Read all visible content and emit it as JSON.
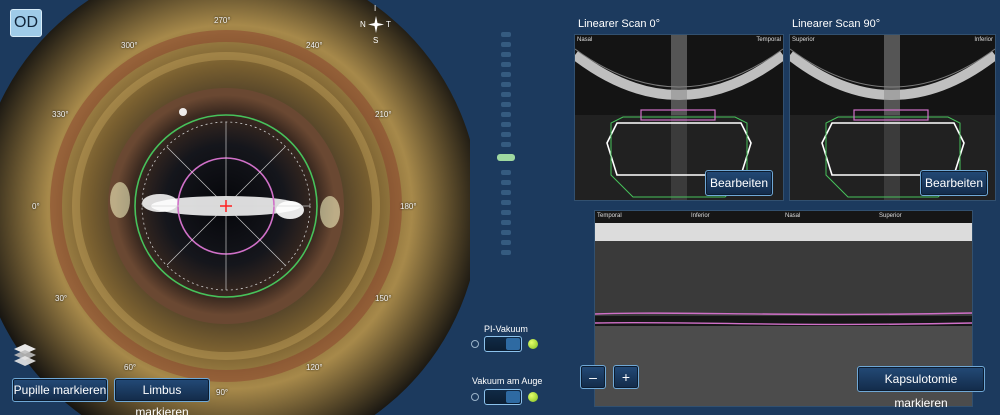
{
  "eye_view": {
    "eye_label": "OD",
    "degree_labels": [
      "270°",
      "240°",
      "210°",
      "180°",
      "150°",
      "120°",
      "90°",
      "60°",
      "30°",
      "0°",
      "330°",
      "300°"
    ],
    "compass": {
      "top": "I",
      "left": "N",
      "right": "T",
      "bottom": "S"
    },
    "buttons": {
      "pupil": "Pupille markieren",
      "limbus": "Limbus markieren"
    }
  },
  "controls": {
    "pi_vacuum_label": "PI-Vakuum",
    "eye_vacuum_label": "Vakuum am Auge"
  },
  "scans": {
    "scan0": {
      "title": "Linearer Scan 0°",
      "left_label": "Nasal",
      "right_label": "Temporal",
      "edit_label": "Bearbeiten"
    },
    "scan90": {
      "title": "Linearer Scan 90°",
      "left_label": "Superior",
      "right_label": "Inferior",
      "edit_label": "Bearbeiten"
    },
    "circular": {
      "labels": [
        "Temporal",
        "Inferior",
        "Nasal",
        "Superior"
      ]
    }
  },
  "bottom_controls": {
    "zoom_out": "–",
    "zoom_in": "+",
    "capsulotomy": "Kapsulotomie markieren"
  },
  "colors": {
    "background": "#1c3a5e",
    "green_ring": "#47c25b",
    "pink_ring": "#d070c8",
    "accent": "#6fa8d6"
  }
}
